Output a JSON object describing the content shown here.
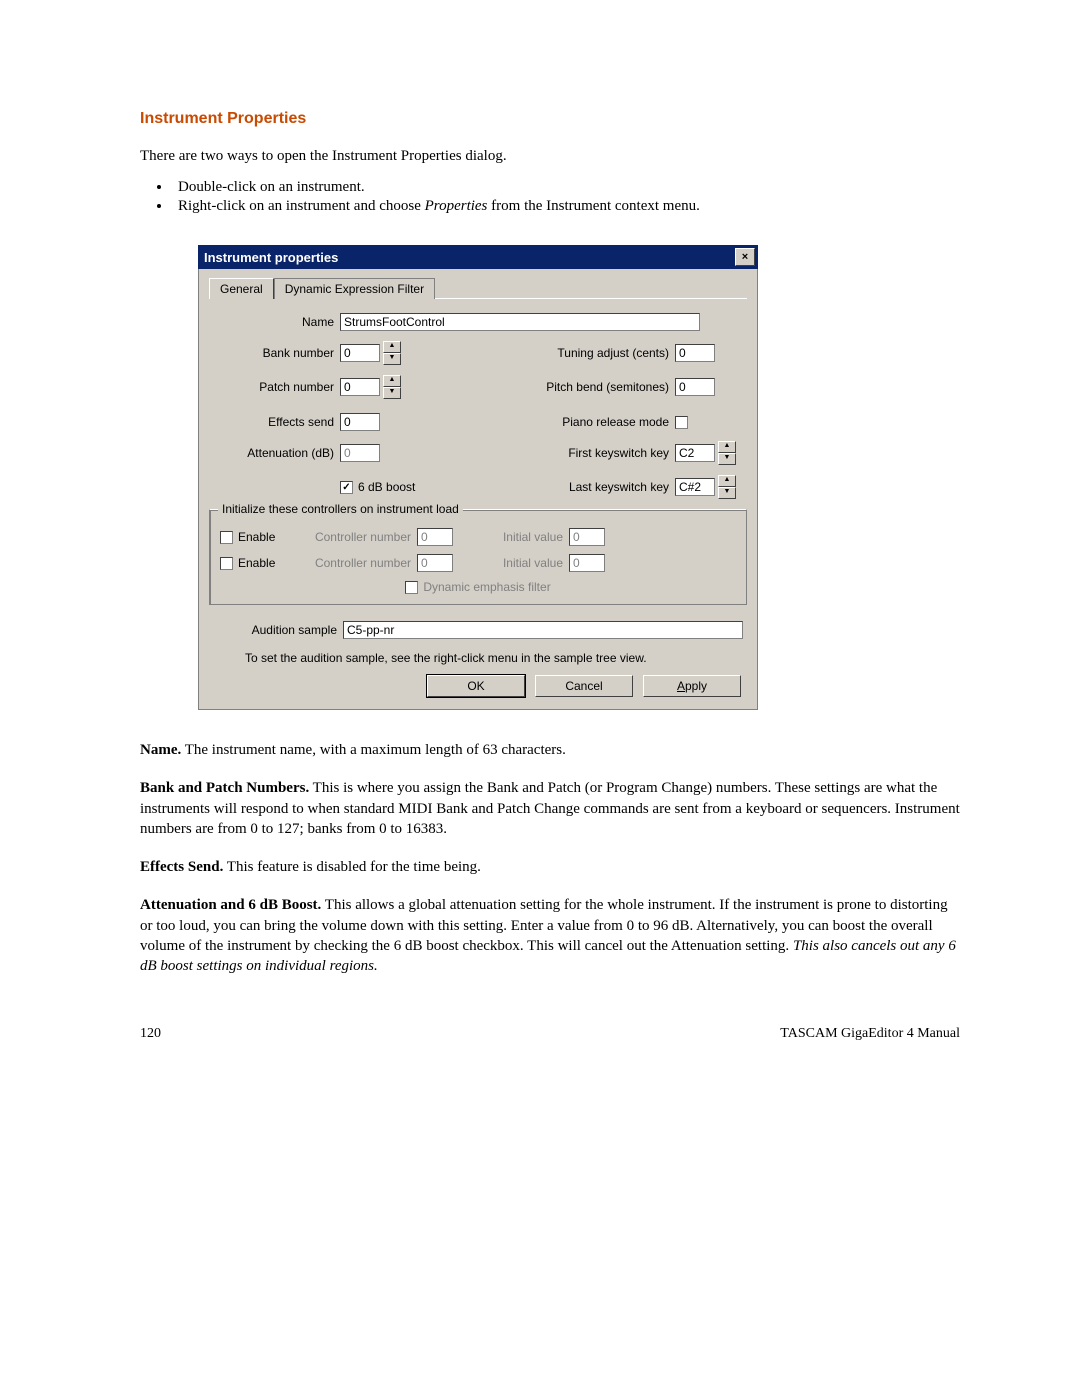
{
  "heading": "Instrument Properties",
  "intro": "There are two ways to open the Instrument Properties dialog.",
  "bullets": {
    "b1": "Double-click on an instrument.",
    "b2_pre": "Right-click on an instrument and choose ",
    "b2_em": "Properties",
    "b2_post": " from the Instrument context menu."
  },
  "dialog": {
    "title": "Instrument properties",
    "close_glyph": "×",
    "tabs": {
      "general": "General",
      "def": "Dynamic Expression Filter"
    },
    "labels": {
      "name": "Name",
      "bank": "Bank number",
      "patch": "Patch number",
      "effects": "Effects send",
      "atten": "Attenuation (dB)",
      "boost": "6 dB boost",
      "tuning": "Tuning adjust (cents)",
      "pitchbend": "Pitch bend (semitones)",
      "piano": "Piano release mode",
      "firstkey": "First keyswitch key",
      "lastkey": "Last keyswitch key",
      "group": "Initialize these controllers on instrument load",
      "enable": "Enable",
      "ctrlnum": "Controller number",
      "initval": "Initial value",
      "deffilter": "Dynamic emphasis filter",
      "audition": "Audition sample"
    },
    "values": {
      "name": "StrumsFootControl",
      "bank": "0",
      "patch": "0",
      "effects": "0",
      "atten": "0",
      "tuning": "0",
      "pitchbend": "0",
      "firstkey": "C2",
      "lastkey": "C#2",
      "ctrl1_num": "0",
      "ctrl1_init": "0",
      "ctrl2_num": "0",
      "ctrl2_init": "0",
      "audition": "C5-pp-nr",
      "check": "✓"
    },
    "hint": "To set the audition sample, see the right-click menu in the sample tree view.",
    "buttons": {
      "ok": "OK",
      "cancel": "Cancel",
      "apply_mnemonic": "A",
      "apply_rest": "pply"
    }
  },
  "descriptions": {
    "name_b": "Name.",
    "name_t": "  The instrument name, with a maximum length of 63 characters.",
    "bank_b": "Bank and Patch Numbers.",
    "bank_t": "  This is where you assign the Bank and Patch (or Program Change) numbers.  These settings are what the instruments will respond to when standard MIDI Bank and Patch Change commands are sent from a keyboard or sequencers.  Instrument numbers are from 0 to 127; banks from 0 to 16383.",
    "eff_b": "Effects Send.",
    "eff_t": "  This feature is disabled for the time being.",
    "att_b": "Attenuation and 6 dB Boost.",
    "att_t": "  This allows a global attenuation setting for the whole instrument.  If the instrument is prone to distorting or too loud, you can bring the volume down with this setting.  Enter a value from 0 to 96 dB.  Alternatively, you can boost the overall volume of the instrument by checking the 6 dB boost checkbox.  This will cancel out the Attenuation setting.  ",
    "att_em": "This also cancels out any 6 dB boost settings on individual regions."
  },
  "footer": {
    "page": "120",
    "manual": "TASCAM GigaEditor 4 Manual"
  }
}
